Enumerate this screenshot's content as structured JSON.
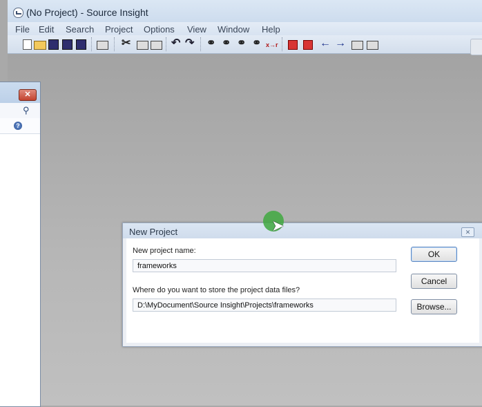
{
  "window": {
    "title": "(No Project) - Source Insight"
  },
  "menubar": [
    "File",
    "Edit",
    "Search",
    "Project",
    "Options",
    "View",
    "Window",
    "Help"
  ],
  "toolbar": {
    "replace_label": "x→r"
  },
  "left_panel": {
    "close_label": "✕",
    "help_label": "?"
  },
  "dialog": {
    "title": "New Project",
    "close_label": "✕",
    "name_label": "New project name:",
    "name_value": "frameworks",
    "location_label": "Where do you want to store the project data files?",
    "location_value": "D:\\MyDocument\\Source Insight\\Projects\\frameworks",
    "ok_label": "OK",
    "cancel_label": "Cancel",
    "browse_label": "Browse..."
  }
}
